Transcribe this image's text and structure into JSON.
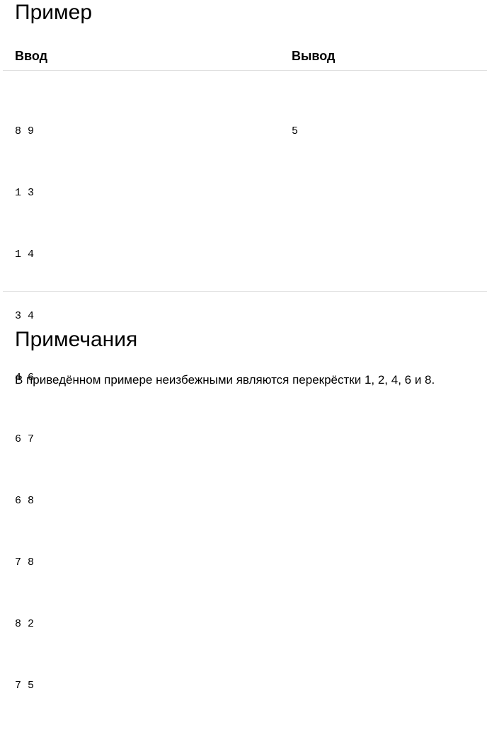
{
  "example": {
    "heading": "Пример",
    "columns": {
      "input": "Ввод",
      "output": "Вывод"
    },
    "input_lines": [
      "8 9",
      "1 3",
      "1 4",
      "3 4",
      "4 6",
      "6 7",
      "6 8",
      "7 8",
      "8 2",
      "7 5"
    ],
    "output_lines": [
      "5"
    ]
  },
  "notes": {
    "heading": "Примечания",
    "text": "В приведённом примере неизбежными являются перекрёстки 1, 2, 4, 6 и 8."
  }
}
